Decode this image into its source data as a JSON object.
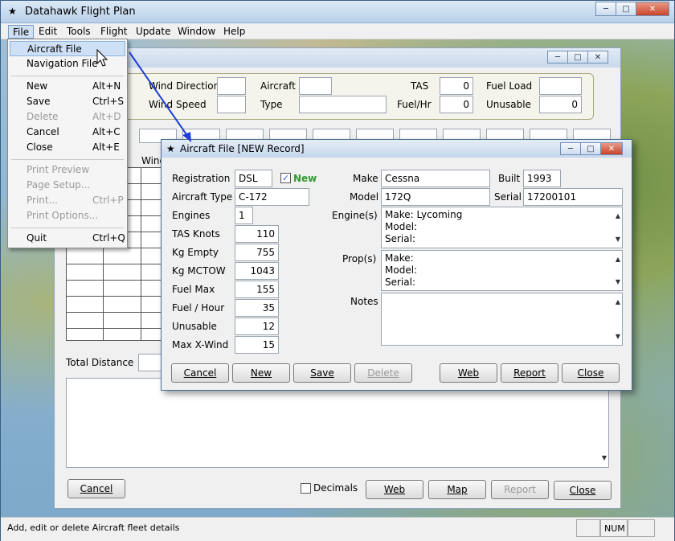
{
  "app": {
    "title": "Datahawk Flight Plan"
  },
  "menubar": [
    "File",
    "Edit",
    "Tools",
    "Flight",
    "Update",
    "Window",
    "Help"
  ],
  "file_menu": {
    "items": [
      {
        "label": "Aircraft File",
        "shortcut": ""
      },
      {
        "label": "Navigation File",
        "shortcut": ""
      },
      {
        "label": "New",
        "shortcut": "Alt+N"
      },
      {
        "label": "Save",
        "shortcut": "Ctrl+S"
      },
      {
        "label": "Delete",
        "shortcut": "Alt+D"
      },
      {
        "label": "Cancel",
        "shortcut": "Alt+C"
      },
      {
        "label": "Close",
        "shortcut": "Alt+E"
      },
      {
        "label": "Print Preview",
        "shortcut": ""
      },
      {
        "label": "Page Setup...",
        "shortcut": ""
      },
      {
        "label": "Print...",
        "shortcut": "Ctrl+P"
      },
      {
        "label": "Print Options...",
        "shortcut": ""
      },
      {
        "label": "Quit",
        "shortcut": "Ctrl+Q"
      }
    ]
  },
  "flight": {
    "wind_direction_label": "Wind Direction",
    "wind_speed_label": "Wind Speed",
    "aircraft_label": "Aircraft",
    "type_label": "Type",
    "tas_label": "TAS",
    "tas_value": "0",
    "fuel_hr_label": "Fuel/Hr",
    "fuel_hr_value": "0",
    "fuel_load_label": "Fuel Load",
    "unusable_label": "Unusable",
    "unusable_value": "0",
    "wind_col_label": "Wind",
    "total_distance_label": "Total Distance",
    "cancel": "Cancel",
    "decimals": "Decimals",
    "web": "Web",
    "map": "Map",
    "report": "Report",
    "close": "Close"
  },
  "dialog": {
    "title": "Aircraft File [NEW Record]",
    "registration_label": "Registration",
    "registration": "DSL",
    "new_label": "New",
    "aircraft_type_label": "Aircraft Type",
    "aircraft_type": "C-172",
    "engines_label": "Engines",
    "engines": "1",
    "tas_knots_label": "TAS Knots",
    "tas_knots": "110",
    "kg_empty_label": "Kg Empty",
    "kg_empty": "755",
    "kg_mctow_label": "Kg MCTOW",
    "kg_mctow": "1043",
    "fuel_max_label": "Fuel Max",
    "fuel_max": "155",
    "fuel_hour_label": "Fuel / Hour",
    "fuel_hour": "35",
    "unusable_label": "Unusable",
    "unusable": "12",
    "max_xwind_label": "Max X-Wind",
    "max_xwind": "15",
    "make_label": "Make",
    "make": "Cessna",
    "built_label": "Built",
    "built": "1993",
    "model_label": "Model",
    "model": "172Q",
    "serial_label": "Serial",
    "serial": "17200101",
    "engines_memo_label": "Engine(s)",
    "engine_lines": [
      "Make: Lycoming",
      "Model:",
      "Serial:"
    ],
    "props_label": "Prop(s)",
    "prop_lines": [
      "Make:",
      "Model:",
      "Serial:"
    ],
    "notes_label": "Notes",
    "buttons": {
      "cancel": "Cancel",
      "new": "New",
      "save": "Save",
      "delete": "Delete",
      "web": "Web",
      "report": "Report",
      "close": "Close"
    }
  },
  "status": {
    "message": "Add, edit or delete Aircraft fleet details",
    "num": "NUM"
  }
}
